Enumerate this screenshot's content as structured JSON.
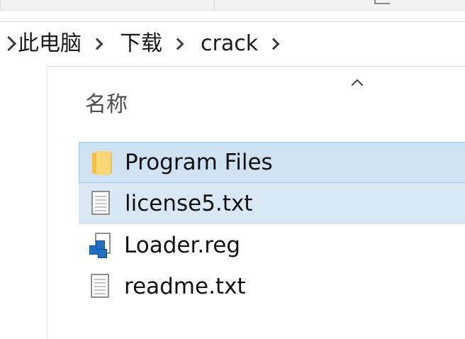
{
  "breadcrumb": {
    "items": [
      "此电脑",
      "下载",
      "crack"
    ]
  },
  "columns": {
    "name_header": "名称"
  },
  "files": [
    {
      "name": "Program Files",
      "icon": "folder-icon",
      "state": "selected"
    },
    {
      "name": "license5.txt",
      "icon": "text-file-icon",
      "state": "hover"
    },
    {
      "name": "Loader.reg",
      "icon": "registry-file-icon",
      "state": "normal"
    },
    {
      "name": "readme.txt",
      "icon": "text-file-icon",
      "state": "normal"
    }
  ],
  "colors": {
    "selection_bg": "#cde3f4",
    "selection_border": "#99c6ea",
    "hover_bg": "#d9e8f5"
  }
}
